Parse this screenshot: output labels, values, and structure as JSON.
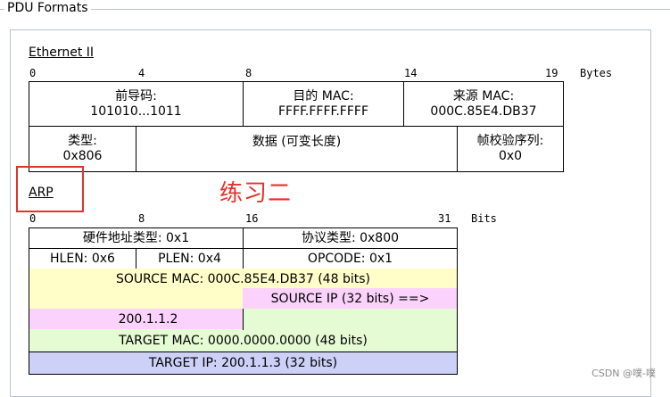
{
  "window": {
    "title": "PDU Formats"
  },
  "ethernet": {
    "title": "Ethernet II",
    "ruler": [
      "0",
      "4",
      "8",
      "14",
      "19"
    ],
    "unit": "Bytes",
    "fields": {
      "preamble": {
        "label": "前导码:",
        "value": "101010...1011"
      },
      "dest_mac": {
        "label": "目的 MAC:",
        "value": "FFFF.FFFF.FFFF"
      },
      "src_mac": {
        "label": "来源 MAC:",
        "value": "000C.85E4.DB37"
      },
      "type": {
        "label": "类型:",
        "value": "0x806"
      },
      "data": {
        "label": "数据 (可变长度)"
      },
      "fcs": {
        "label": "帧校验序列:",
        "value": "0x0"
      }
    }
  },
  "annotation": {
    "text": "练习二"
  },
  "arp": {
    "title": "ARP",
    "ruler": [
      "0",
      "8",
      "16",
      "31"
    ],
    "unit": "Bits",
    "fields": {
      "hw_type": "硬件地址类型: 0x1",
      "proto_type": "协议类型: 0x800",
      "hlen": "HLEN: 0x6",
      "plen": "PLEN: 0x4",
      "opcode": "OPCODE: 0x1",
      "source_mac": "SOURCE MAC: 000C.85E4.DB37 (48 bits)",
      "source_ip_label": "SOURCE IP (32 bits) ==>",
      "source_ip_value": "200.1.1.2",
      "target_mac": "TARGET MAC: 0000.0000.0000 (48 bits)",
      "target_ip": "TARGET IP: 200.1.1.3 (32 bits)"
    },
    "colors": {
      "yellow": "#fffdc8",
      "pink": "#fbd2fb",
      "green": "#e5fbd3",
      "blue": "#cdd0f7"
    }
  },
  "watermark": {
    "text": "CSDN @噗-噗"
  }
}
